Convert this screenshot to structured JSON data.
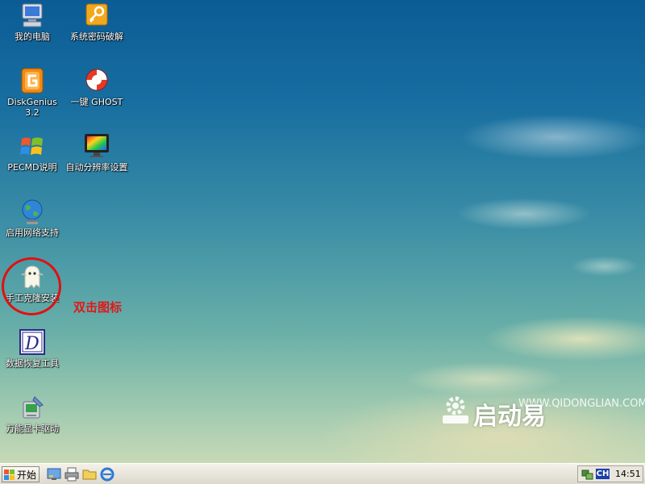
{
  "desktop": {
    "icons": [
      {
        "label": "我的电脑",
        "icon": "my-computer-icon"
      },
      {
        "label": "系统密码破解",
        "icon": "key-icon"
      },
      {
        "label": "DiskGenius 3.2",
        "icon": "diskgenius-icon"
      },
      {
        "label": "一键 GHOST",
        "icon": "lifebuoy-icon"
      },
      {
        "label": "PECMD说明",
        "icon": "windows-flag-icon"
      },
      {
        "label": "自动分辨率设置",
        "icon": "monitor-icon"
      },
      {
        "label": "启用网络支持",
        "icon": "globe-icon"
      },
      {
        "label": "手工克隆安装",
        "icon": "ghost-icon"
      },
      {
        "label": "数据恢复工具",
        "icon": "d-letter-icon"
      },
      {
        "label": "万能显卡驱动",
        "icon": "driver-icon"
      }
    ],
    "annotation": "双击图标",
    "watermark": {
      "brand": "启动易",
      "url": "WWW.QIDONGLIAN.COM"
    }
  },
  "taskbar": {
    "start_label": "开始",
    "quick_launch": [
      "show-desktop-icon",
      "printer-icon",
      "folder-icon",
      "ie-icon"
    ],
    "tray": {
      "lang": "CH",
      "clock": "14:51"
    }
  },
  "colors": {
    "annotation": "#e01010",
    "taskbar": "#ece9d8"
  }
}
